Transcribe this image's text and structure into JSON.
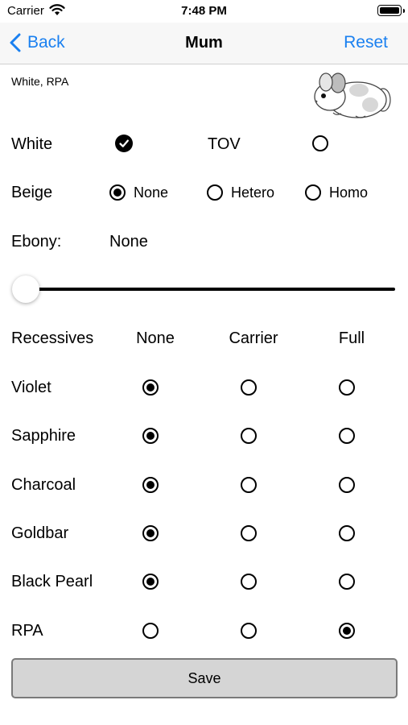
{
  "status_bar": {
    "carrier": "Carrier",
    "time": "7:48 PM"
  },
  "nav": {
    "back_label": "Back",
    "title": "Mum",
    "reset_label": "Reset"
  },
  "summary": "White, RPA",
  "white_row": {
    "label": "White",
    "white_selected": true,
    "tov_label": "TOV",
    "tov_selected": false
  },
  "beige": {
    "label": "Beige",
    "options": [
      "None",
      "Hetero",
      "Homo"
    ],
    "selected": "None"
  },
  "ebony": {
    "label": "Ebony:",
    "value": "None",
    "slider_level": 0
  },
  "recessives": {
    "header": "Recessives",
    "columns": [
      "None",
      "Carrier",
      "Full"
    ],
    "rows": [
      {
        "name": "Violet",
        "selected": "None"
      },
      {
        "name": "Sapphire",
        "selected": "None"
      },
      {
        "name": "Charcoal",
        "selected": "None"
      },
      {
        "name": "Goldbar",
        "selected": "None"
      },
      {
        "name": "Black Pearl",
        "selected": "None"
      },
      {
        "name": "RPA",
        "selected": "Full"
      }
    ]
  },
  "save_label": "Save",
  "colors": {
    "accent": "#1a80f0",
    "nav_background": "#f7f7f7",
    "button_background": "#d5d5d5"
  }
}
